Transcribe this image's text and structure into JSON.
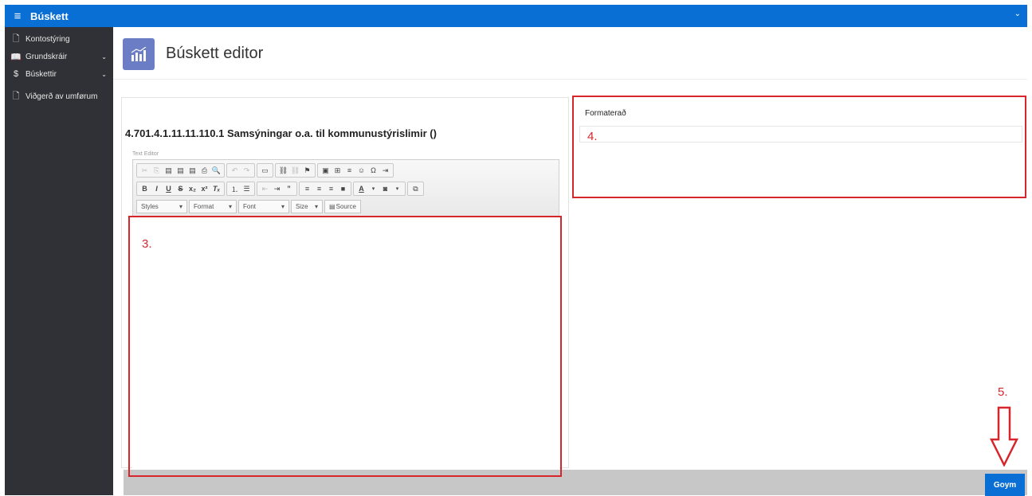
{
  "app": {
    "title": "Búskett"
  },
  "sidebar": {
    "items": [
      {
        "label": "Kontostýring",
        "icon": "page-icon"
      },
      {
        "label": "Grundskráir",
        "icon": "book-icon"
      },
      {
        "label": "Búskettir",
        "icon": "dollar-icon"
      },
      {
        "label": "Viðgerð av umførum",
        "icon": "page-icon"
      }
    ]
  },
  "header": {
    "title": "Búskett editor"
  },
  "editor": {
    "item_title": "4.701.4.1.11.11.110.1 Samsýningar o.a. til kommunustýrislimir ()",
    "label": "Text Editor",
    "combos": {
      "styles": "Styles",
      "format": "Format",
      "font": "Font",
      "size": "Size"
    },
    "source_label": "Source"
  },
  "right": {
    "format_label": "Formaterað"
  },
  "annotations": {
    "a3": "3.",
    "a4": "4.",
    "a5": "5."
  },
  "footer": {
    "save_label": "Goym"
  },
  "colors": {
    "accent": "#0a6fd4",
    "annotation": "#d6262c",
    "sidebar": "#2f3136"
  }
}
